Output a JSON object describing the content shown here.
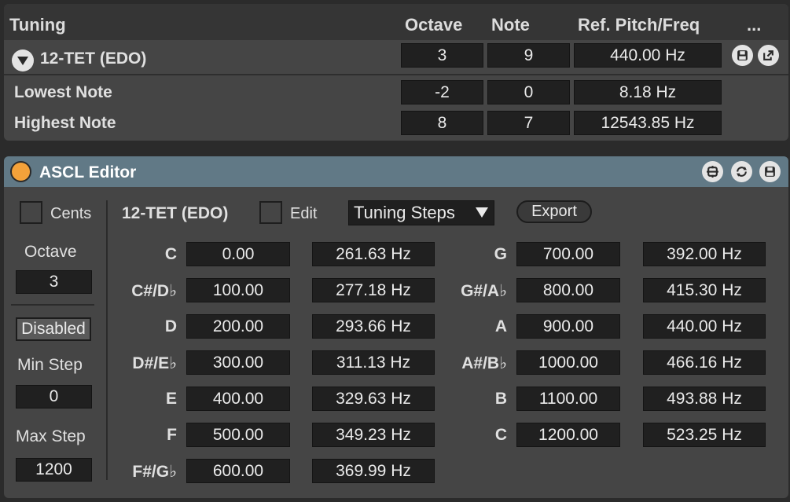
{
  "tuning": {
    "header": {
      "title": "Tuning",
      "octave": "Octave",
      "note": "Note",
      "ref": "Ref. Pitch/Freq",
      "more": "..."
    },
    "preset": {
      "name": "12-TET (EDO)",
      "octave": "3",
      "note": "9",
      "freq": "440.00 Hz"
    },
    "lowest": {
      "label": "Lowest Note",
      "octave": "-2",
      "note": "0",
      "freq": "8.18 Hz"
    },
    "highest": {
      "label": "Highest Note",
      "octave": "8",
      "note": "7",
      "freq": "12543.85 Hz"
    }
  },
  "editor": {
    "title": "ASCL Editor",
    "cents_label": "Cents",
    "octave_label": "Octave",
    "octave_value": "3",
    "disabled_label": "Disabled",
    "min_step_label": "Min Step",
    "min_step_value": "0",
    "max_step_label": "Max Step",
    "max_step_value": "1200",
    "tuning_name": "12-TET (EDO)",
    "edit_label": "Edit",
    "view_select": "Tuning Steps",
    "export_label": "Export",
    "steps": [
      {
        "note": "C",
        "cents": "0.00",
        "freq": "261.63 Hz"
      },
      {
        "note": "C#/D♭",
        "cents": "100.00",
        "freq": "277.18 Hz"
      },
      {
        "note": "D",
        "cents": "200.00",
        "freq": "293.66 Hz"
      },
      {
        "note": "D#/E♭",
        "cents": "300.00",
        "freq": "311.13 Hz"
      },
      {
        "note": "E",
        "cents": "400.00",
        "freq": "329.63 Hz"
      },
      {
        "note": "F",
        "cents": "500.00",
        "freq": "349.23 Hz"
      },
      {
        "note": "F#/G♭",
        "cents": "600.00",
        "freq": "369.99 Hz"
      },
      {
        "note": "G",
        "cents": "700.00",
        "freq": "392.00 Hz"
      },
      {
        "note": "G#/A♭",
        "cents": "800.00",
        "freq": "415.30 Hz"
      },
      {
        "note": "A",
        "cents": "900.00",
        "freq": "440.00 Hz"
      },
      {
        "note": "A#/B♭",
        "cents": "1000.00",
        "freq": "466.16 Hz"
      },
      {
        "note": "B",
        "cents": "1100.00",
        "freq": "493.88 Hz"
      },
      {
        "note": "C",
        "cents": "1200.00",
        "freq": "523.25 Hz"
      }
    ]
  },
  "colors": {
    "header_bar": "#617986",
    "accent_dot": "#f4a23a",
    "field_bg": "#202020",
    "panel_bg": "#454545"
  },
  "icons": [
    "triangle-down-icon",
    "save-icon",
    "external-link-icon",
    "grid-icon",
    "sync-icon",
    "save-icon"
  ]
}
